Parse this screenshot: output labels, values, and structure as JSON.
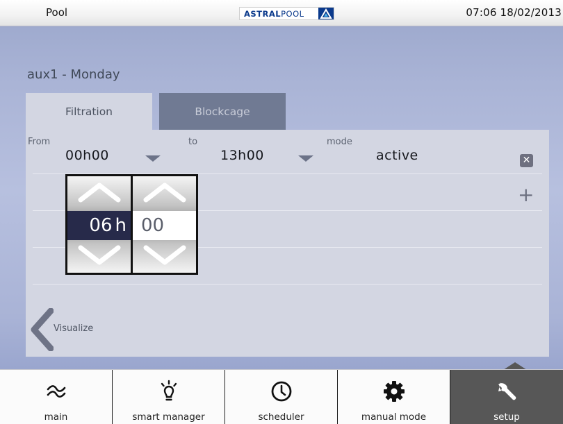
{
  "statusbar": {
    "app_name": "Pool",
    "logo_text_bold": "ASTRAL",
    "logo_text_thin": "POOL",
    "time_date": "07:06  18/02/2013"
  },
  "panel": {
    "title": "aux1 - Monday",
    "tabs": [
      {
        "label": "Filtration",
        "active": true
      },
      {
        "label": "Blockcage",
        "active": false
      }
    ],
    "from_label": "From",
    "from_value": "00h00",
    "to_label": "to",
    "to_value": "13h00",
    "mode_label": "mode",
    "mode_value": "active",
    "visualize_label": "Visualize"
  },
  "spinner": {
    "hours": "06",
    "hours_unit": "h",
    "minutes": "00"
  },
  "nav": [
    {
      "label": "main",
      "icon": "approx-wave-icon"
    },
    {
      "label": "smart manager",
      "icon": "lightbulb-icon"
    },
    {
      "label": "scheduler",
      "icon": "clock-icon"
    },
    {
      "label": "manual mode",
      "icon": "gear-icon"
    },
    {
      "label": "setup",
      "icon": "wrench-icon",
      "active": true
    }
  ],
  "colors": {
    "accent_dark": "#272a4a",
    "nav_active": "#575757",
    "logo_blue": "#0b3a8c"
  }
}
